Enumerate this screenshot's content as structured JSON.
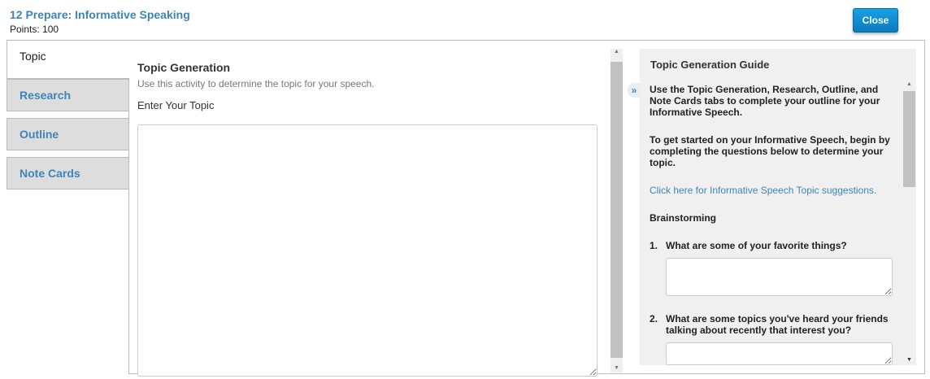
{
  "header": {
    "title": "12 Prepare: Informative Speaking",
    "points": "Points: 100",
    "close_label": "Close"
  },
  "tabs": [
    {
      "label": "Topic"
    },
    {
      "label": "Research"
    },
    {
      "label": "Outline"
    },
    {
      "label": "Note Cards"
    }
  ],
  "main": {
    "title": "Topic Generation",
    "description": "Use this activity to determine the topic for your speech.",
    "input_label": "Enter Your Topic",
    "input_value": ""
  },
  "guide": {
    "title": "Topic Generation Guide",
    "expand_icon": "»",
    "para1": "Use the Topic Generation, Research, Outline, and Note Cards tabs to complete your outline for your Informative Speech.",
    "para2": "To get started on your Informative Speech, begin by completing the questions below to determine your topic.",
    "link": "Click here for Informative Speech Topic suggestions.",
    "section": "Brainstorming",
    "questions": [
      {
        "num": "1.",
        "text": "What are some of your favorite things?"
      },
      {
        "num": "2.",
        "text": "What are some topics you've heard your friends talking about recently that interest you?"
      }
    ]
  }
}
